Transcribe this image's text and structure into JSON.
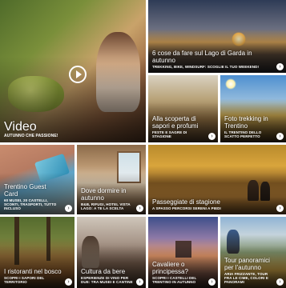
{
  "tiles": [
    {
      "title": "Video",
      "subtitle": "Autunno che passione!"
    },
    {
      "title": "6 cose da fare sul Lago di Garda in autunno",
      "subtitle": "Trekking, bike, windsurf: scoglie il tuo weekend!"
    },
    {
      "title": "Alla scoperta di sapori e profumi",
      "subtitle": "Feste e sagre di stagione"
    },
    {
      "title": "Foto trekking in Trentino",
      "subtitle": "Il Trentino dello scatto perfetto"
    },
    {
      "title": "Trentino Guest Card",
      "subtitle": "60 musei, 20 castelli, sconti, trasporti, tutto incluso"
    },
    {
      "title": "Dove dormire in autunno",
      "subtitle": "B&B, rifugi, hotel vista lago: a te la scelta"
    },
    {
      "title": "Passeggiate di stagione",
      "subtitle": "A spasso percorsi sereni a piedi"
    },
    {
      "title": "I ristoranti nel bosco",
      "subtitle": "Scopri i sapori del territorio"
    },
    {
      "title": "Cultura da bere",
      "subtitle": "Esperienze di vino per due: tra musei e cantine"
    },
    {
      "title": "Cavaliere o principessa?",
      "subtitle": "Scopri i castelli del Trentino in autunno"
    },
    {
      "title": "Tour panoramici per l'autunno",
      "subtitle": "Aria frizzante, tour fra le cime, colori e panorami"
    }
  ],
  "arrow_glyph": "›"
}
